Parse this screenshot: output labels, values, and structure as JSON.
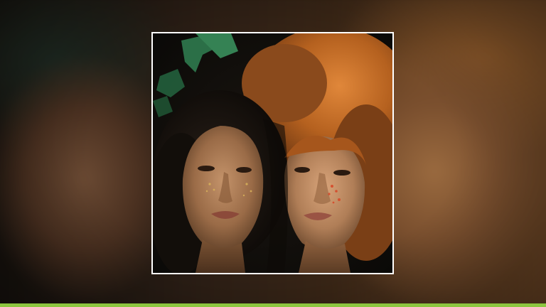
{
  "image": {
    "description_icon": "photo-icon",
    "subject": "two-faces-portrait"
  },
  "colors": {
    "frame_border": "#ffffff",
    "accent_bar": "#8cc63f",
    "left_hair": "#1a1410",
    "right_hair": "#b8662a",
    "skin_left": "#b07a52",
    "skin_right": "#c89068",
    "foliage": "#2f7a4e"
  }
}
